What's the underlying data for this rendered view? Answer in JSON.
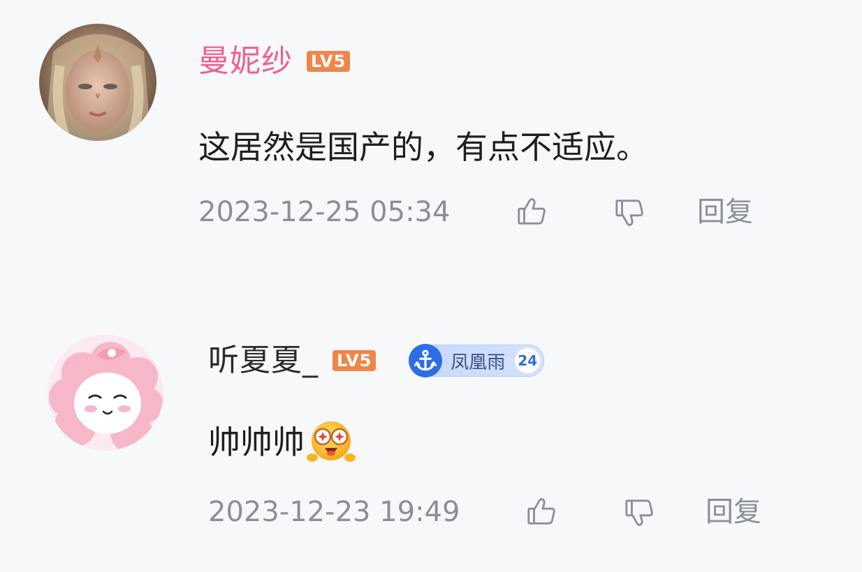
{
  "comments": [
    {
      "username": "曼妮纱",
      "username_color": "#ef5f8c",
      "level": "LV5",
      "level_color": "#f08547",
      "text": "这居然是国产的，有点不适应。",
      "timestamp": "2023-12-25 05:34",
      "like_icon": "thumbs-up-icon",
      "dislike_icon": "thumbs-down-icon",
      "reply_label": "回复"
    },
    {
      "username": "听夏夏_",
      "username_color": "#2a2a2a",
      "level": "LV5",
      "level_color": "#f08547",
      "fan_badge": {
        "name": "凤凰雨",
        "level": "24",
        "icon": "anchor-icon",
        "color": "#2f6de4"
      },
      "text": "帅帅帅",
      "emoji": "starstruck-emoji-icon",
      "timestamp": "2023-12-23 19:49",
      "like_icon": "thumbs-up-icon",
      "dislike_icon": "thumbs-down-icon",
      "reply_label": "回复"
    }
  ]
}
